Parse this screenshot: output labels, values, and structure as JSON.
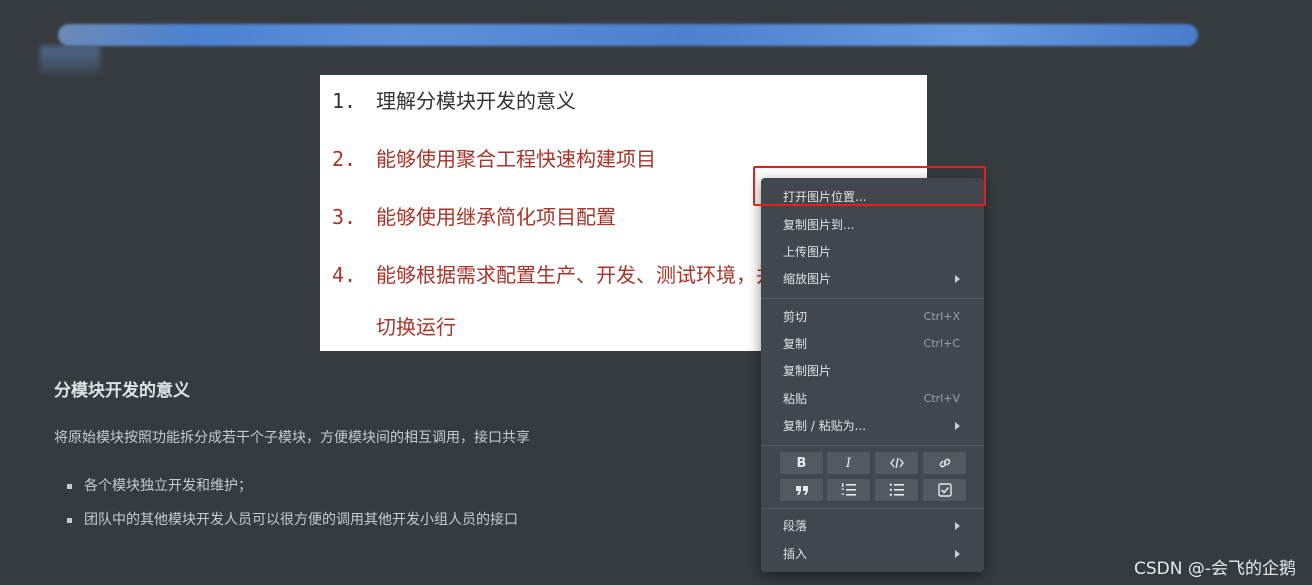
{
  "embedded_image": {
    "items": [
      {
        "num": "1.",
        "text": "理解分模块开发的意义"
      },
      {
        "num": "2.",
        "text": "能够使用聚合工程快速构建项目"
      },
      {
        "num": "3.",
        "text": "能够使用继承简化项目配置"
      },
      {
        "num": "4.",
        "text": "能够根据需求配置生产、开发、测试环境，并在各个环境间"
      },
      {
        "num": "",
        "text": "切换运行"
      }
    ]
  },
  "document": {
    "heading": "分模块开发的意义",
    "paragraph": "将原始模块按照功能拆分成若干个子模块，方便模块间的相互调用，接口共享",
    "bullets": [
      "各个模块独立开发和维护；",
      "团队中的其他模块开发人员可以很方便的调用其他开发小组人员的接口"
    ]
  },
  "context_menu": {
    "items": [
      {
        "label": "打开图片位置...",
        "shortcut": "",
        "submenu": false
      },
      {
        "label": "复制图片到...",
        "shortcut": "",
        "submenu": false
      },
      {
        "label": "上传图片",
        "shortcut": "",
        "submenu": false
      },
      {
        "label": "缩放图片",
        "shortcut": "",
        "submenu": true
      },
      {
        "label": "剪切",
        "shortcut": "Ctrl+X",
        "submenu": false
      },
      {
        "label": "复制",
        "shortcut": "Ctrl+C",
        "submenu": false
      },
      {
        "label": "复制图片",
        "shortcut": "",
        "submenu": false
      },
      {
        "label": "粘贴",
        "shortcut": "Ctrl+V",
        "submenu": false
      },
      {
        "label": "复制 / 粘贴为...",
        "shortcut": "",
        "submenu": true
      },
      {
        "label": "段落",
        "shortcut": "",
        "submenu": true
      },
      {
        "label": "插入",
        "shortcut": "",
        "submenu": true
      }
    ],
    "format_buttons": [
      "bold-icon",
      "italic-icon",
      "code-icon",
      "link-icon",
      "quote-icon",
      "ordered-list-icon",
      "unordered-list-icon",
      "task-list-icon"
    ],
    "format_glyphs": {
      "bold": "B",
      "italic": "I"
    }
  },
  "watermark": "CSDN @-会飞的企鹅",
  "colors": {
    "background": "#363B40",
    "menu_background": "#42474d",
    "highlight_border": "#e0211d",
    "red_text": "#a8352a"
  }
}
